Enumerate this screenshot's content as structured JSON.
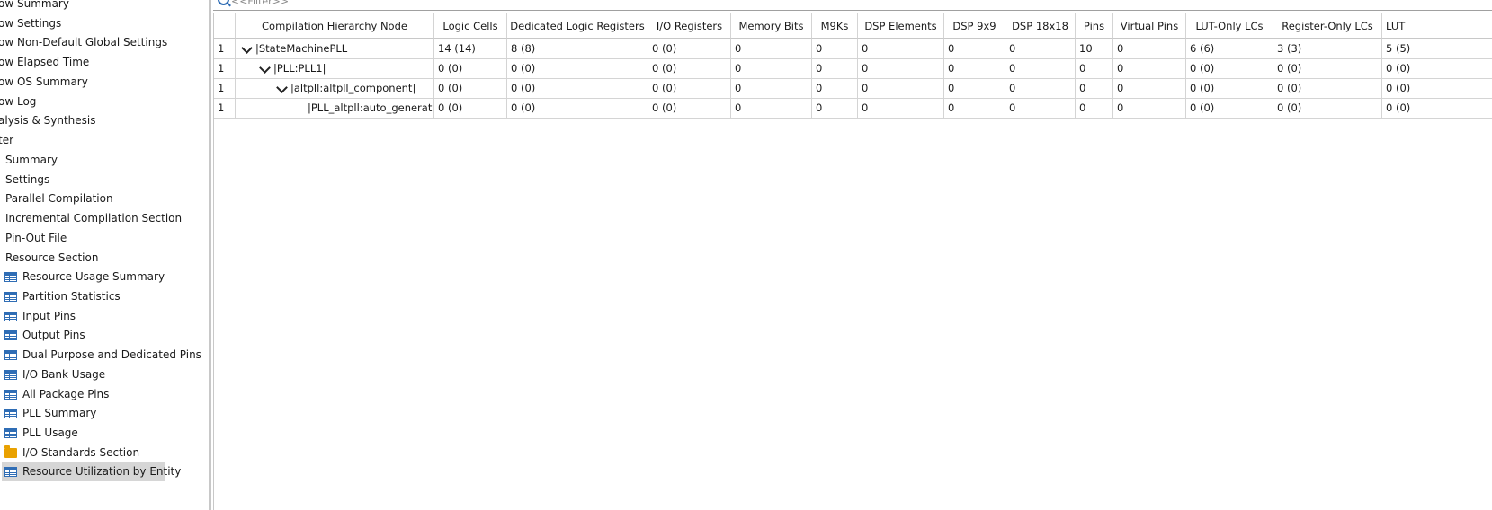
{
  "sidebar": {
    "items": [
      {
        "label": "ow Summary",
        "icon": null,
        "selected": false
      },
      {
        "label": "ow Settings",
        "icon": null,
        "selected": false
      },
      {
        "label": "ow Non-Default Global Settings",
        "icon": null,
        "selected": false
      },
      {
        "label": "ow Elapsed Time",
        "icon": null,
        "selected": false
      },
      {
        "label": "ow OS Summary",
        "icon": null,
        "selected": false
      },
      {
        "label": "ow Log",
        "icon": null,
        "selected": false
      },
      {
        "label": "alysis & Synthesis",
        "icon": null,
        "selected": false
      },
      {
        "label": "ter",
        "icon": null,
        "selected": false
      },
      {
        "label": "Summary",
        "icon": null,
        "selected": false
      },
      {
        "label": "Settings",
        "icon": null,
        "selected": false
      },
      {
        "label": "Parallel Compilation",
        "icon": null,
        "selected": false
      },
      {
        "label": "Incremental Compilation Section",
        "icon": null,
        "selected": false
      },
      {
        "label": "Pin-Out File",
        "icon": null,
        "selected": false
      },
      {
        "label": "Resource Section",
        "icon": null,
        "selected": false
      },
      {
        "label": "Resource Usage Summary",
        "icon": "table-icon",
        "selected": false
      },
      {
        "label": "Partition Statistics",
        "icon": "table-icon",
        "selected": false
      },
      {
        "label": "Input Pins",
        "icon": "table-icon",
        "selected": false
      },
      {
        "label": "Output Pins",
        "icon": "table-icon",
        "selected": false
      },
      {
        "label": "Dual Purpose and Dedicated Pins",
        "icon": "table-icon",
        "selected": false
      },
      {
        "label": "I/O Bank Usage",
        "icon": "table-icon",
        "selected": false
      },
      {
        "label": "All Package Pins",
        "icon": "table-icon",
        "selected": false
      },
      {
        "label": "PLL Summary",
        "icon": "table-icon",
        "selected": false
      },
      {
        "label": "PLL Usage",
        "icon": "table-icon",
        "selected": false
      },
      {
        "label": "I/O Standards Section",
        "icon": "folder-icon",
        "selected": false
      },
      {
        "label": "Resource Utilization by Entity",
        "icon": "table-icon",
        "selected": true
      }
    ]
  },
  "filter": {
    "placeholder": "<<Filter>>",
    "icon": "search-icon"
  },
  "table": {
    "columns": [
      "",
      "Compilation Hierarchy Node",
      "Logic Cells",
      "Dedicated Logic Registers",
      "I/O Registers",
      "Memory Bits",
      "M9Ks",
      "DSP Elements",
      "DSP 9x9",
      "DSP 18x18",
      "Pins",
      "Virtual Pins",
      "LUT-Only LCs",
      "Register-Only LCs",
      "LUT"
    ],
    "rows": [
      {
        "expandable": true,
        "depth": 0,
        "cells": [
          "1",
          "|StateMachinePLL",
          "14 (14)",
          "8 (8)",
          "0 (0)",
          "0",
          "0",
          "0",
          "0",
          "0",
          "10",
          "0",
          "6 (6)",
          "3 (3)",
          "5 (5)"
        ]
      },
      {
        "expandable": true,
        "depth": 1,
        "cells": [
          "1",
          "|PLL:PLL1|",
          "0 (0)",
          "0 (0)",
          "0 (0)",
          "0",
          "0",
          "0",
          "0",
          "0",
          "0",
          "0",
          "0 (0)",
          "0 (0)",
          "0 (0)"
        ]
      },
      {
        "expandable": true,
        "depth": 2,
        "cells": [
          "1",
          "|altpll:altpll_component|",
          "0 (0)",
          "0 (0)",
          "0 (0)",
          "0",
          "0",
          "0",
          "0",
          "0",
          "0",
          "0",
          "0 (0)",
          "0 (0)",
          "0 (0)"
        ]
      },
      {
        "expandable": false,
        "depth": 3,
        "cells": [
          "1",
          "|PLL_altpll:auto_generated|",
          "0 (0)",
          "0 (0)",
          "0 (0)",
          "0",
          "0",
          "0",
          "0",
          "0",
          "0",
          "0",
          "0 (0)",
          "0 (0)",
          "0 (0)"
        ]
      }
    ]
  }
}
